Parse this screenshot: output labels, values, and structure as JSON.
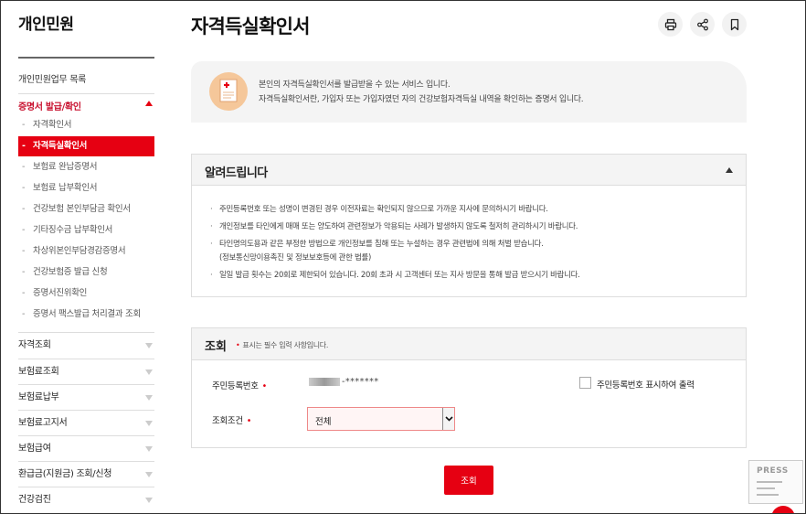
{
  "sidebar": {
    "title": "개인민원",
    "top_item": "개인민원업무 목록",
    "active_section": "증명서 발급/확인",
    "sub_items": [
      {
        "label": "자격확인서",
        "active": false
      },
      {
        "label": "자격득실확인서",
        "active": true
      },
      {
        "label": "보험료 완납증명서",
        "active": false
      },
      {
        "label": "보험료 납부확인서",
        "active": false
      },
      {
        "label": "건강보험 본인부담금 확인서",
        "active": false
      },
      {
        "label": "기타징수금 납부확인서",
        "active": false
      },
      {
        "label": "차상위본인부담경감증명서",
        "active": false
      },
      {
        "label": "건강보험증 발급 신청",
        "active": false
      },
      {
        "label": "증명서진위확인",
        "active": false
      },
      {
        "label": "증명서 팩스발급 처리결과 조회",
        "active": false
      }
    ],
    "categories": [
      "자격조회",
      "보험료조회",
      "보험료납부",
      "보험료고지서",
      "보험급여",
      "환급금(지원금) 조회/신청",
      "건강검진"
    ]
  },
  "header": {
    "title": "자격득실확인서",
    "print_icon": "printer-icon",
    "share_icon": "share-icon",
    "bookmark_icon": "bookmark-icon"
  },
  "info": {
    "line1": "본인의 자격득실확인서를 발급받을 수 있는 서비스 입니다.",
    "line2": "자격득실확인서란, 가입자 또는 가입자였던 자의 건강보험자격득실 내역을 확인하는 증명서 입니다."
  },
  "notice": {
    "title": "알려드립니다",
    "lines": [
      "주민등록번호 또는 성명이 변경된 경우 이전자료는 확인되지 않으므로 가까운 지사에 문의하시기 바랍니다.",
      "개인정보를 타인에게 매매 또는 양도하여 관련정보가 악용되는 사례가 발생하지 않도록 철저히 관리하시기 바랍니다.",
      "타인명의도용과 같은 부정한 방법으로 개인정보를 침해 또는 누설하는 경우 관련법에 의해 처벌 받습니다.",
      "(정보통신망이용촉진 및 정보보호등에 관한 법률)",
      "일일 발급 횟수는 20회로 제한되어 있습니다. 20회 초과 시 고객센터 또는 지사 방문을 통해 발급 받으시기 바랍니다."
    ]
  },
  "query": {
    "title": "조회",
    "required_note": "표시는 필수 입력 사항입니다.",
    "rrn_label": "주민등록번호",
    "rrn_value": "-*******",
    "show_rrn_label": "주민등록번호 표시하여 출력",
    "condition_label": "조회조건",
    "condition_value": "전체",
    "submit_label": "조회"
  },
  "press_badge": "PRESS",
  "colors": {
    "accent": "#e60012",
    "panel": "#f4f4f4"
  }
}
